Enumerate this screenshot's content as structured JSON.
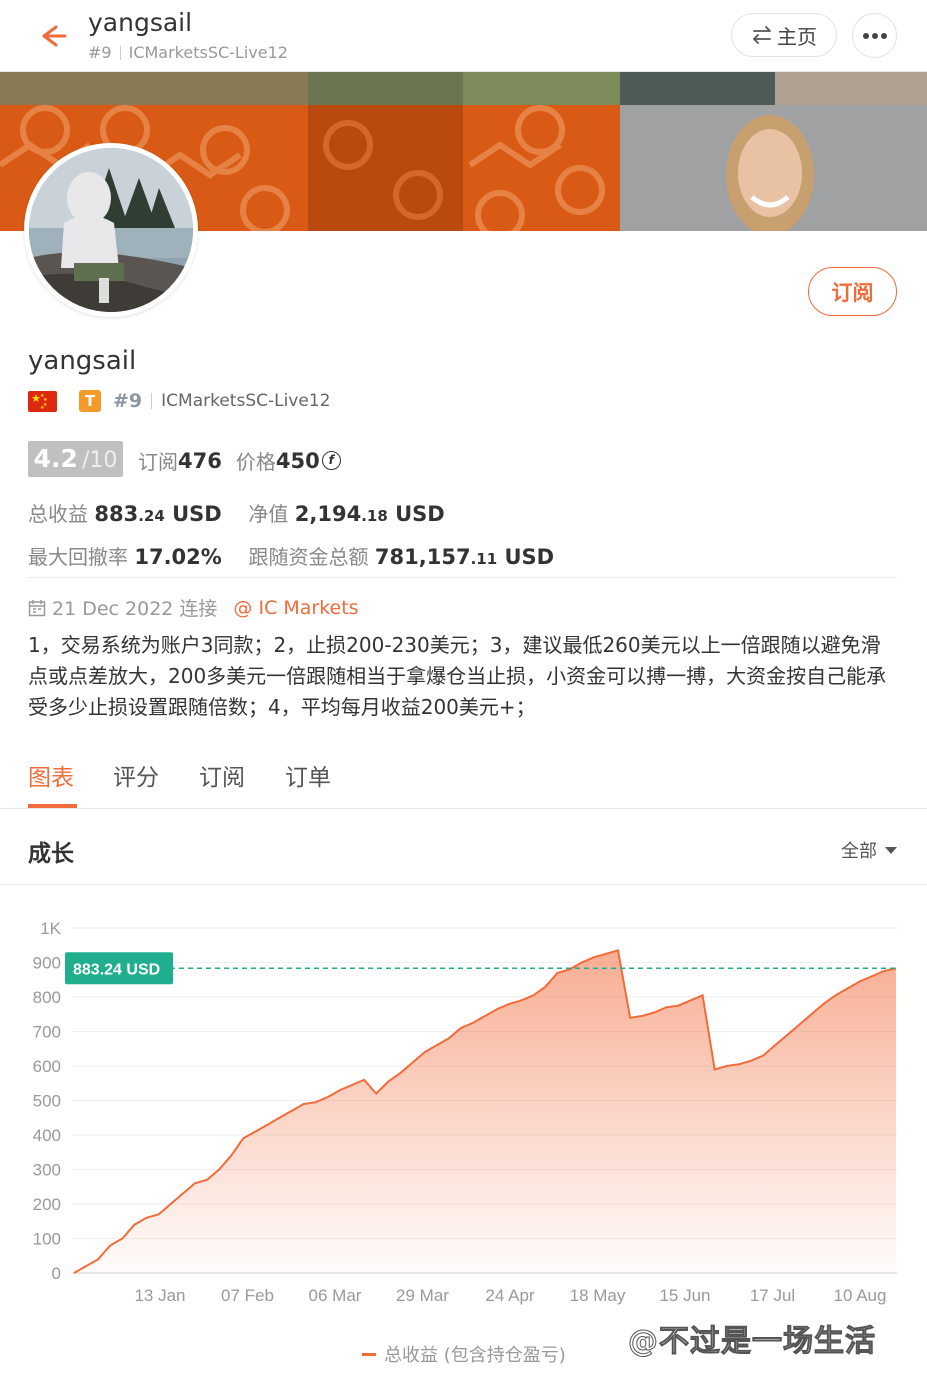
{
  "header": {
    "name": "yangsail",
    "rank": "#9",
    "server": "ICMarketsSC-Live12",
    "home_label": "主页"
  },
  "profile": {
    "name": "yangsail",
    "rank": "#9",
    "server": "ICMarketsSC-Live12",
    "badge_letter": "T",
    "subscribe_label": "订阅"
  },
  "stats": {
    "rating": "4.2",
    "rating_max": "/10",
    "subscribers_label": "订阅",
    "subscribers": "476",
    "price_label": "价格",
    "price": "450",
    "total_profit_label": "总收益",
    "total_profit_int": "883",
    "total_profit_dec": ".24",
    "currency": "USD",
    "equity_label": "净值",
    "equity_int": "2,194",
    "equity_dec": ".18",
    "max_drawdown_label": "最大回撤率",
    "max_drawdown": "17.02%",
    "copy_funds_label": "跟随资金总额",
    "copy_funds_int": "781,157",
    "copy_funds_dec": ".11"
  },
  "meta": {
    "connected": "21 Dec 2022 连接",
    "broker": "@ IC Markets"
  },
  "description": "1，交易系统为账户3同款；2，止损200-230美元；3，建议最低260美元以上一倍跟随以避免滑点或点差放大，200多美元一倍跟随相当于拿爆仓当止损，小资金可以搏一搏，大资金按自己能承受多少止损设置跟随倍数；4，平均每月收益200美元+；",
  "tabs": [
    "图表",
    "评分",
    "订阅",
    "订单"
  ],
  "growth": {
    "title": "成长",
    "range_label": "全部"
  },
  "chart_data": {
    "type": "area",
    "ylim": [
      0,
      1000
    ],
    "yticks": [
      "0",
      "100",
      "200",
      "300",
      "400",
      "500",
      "600",
      "700",
      "800",
      "900",
      "1K"
    ],
    "xticks": [
      "13 Jan",
      "07 Feb",
      "06 Mar",
      "29 Mar",
      "24 Apr",
      "18 May",
      "15 Jun",
      "17 Jul",
      "10 Aug"
    ],
    "current_value": 883.24,
    "current_label": "883.24 USD",
    "series": [
      {
        "name": "总收益 (包含持仓盈亏)",
        "color": "#f26b3a",
        "values": [
          0,
          20,
          40,
          80,
          100,
          140,
          160,
          170,
          200,
          230,
          260,
          270,
          300,
          340,
          390,
          410,
          430,
          450,
          470,
          490,
          495,
          510,
          530,
          545,
          560,
          520,
          555,
          580,
          610,
          640,
          660,
          680,
          710,
          725,
          745,
          765,
          780,
          790,
          805,
          830,
          870,
          880,
          900,
          915,
          925,
          935,
          740,
          745,
          755,
          770,
          775,
          790,
          805,
          590,
          600,
          605,
          615,
          630,
          660,
          690,
          720,
          750,
          780,
          805,
          825,
          845,
          860,
          875,
          883
        ]
      }
    ]
  },
  "legend_label": "总收益 (包含持仓盈亏)",
  "watermark": "@不过是一场生活",
  "colors": {
    "accent": "#f26b3a",
    "teal": "#1fae8e"
  }
}
